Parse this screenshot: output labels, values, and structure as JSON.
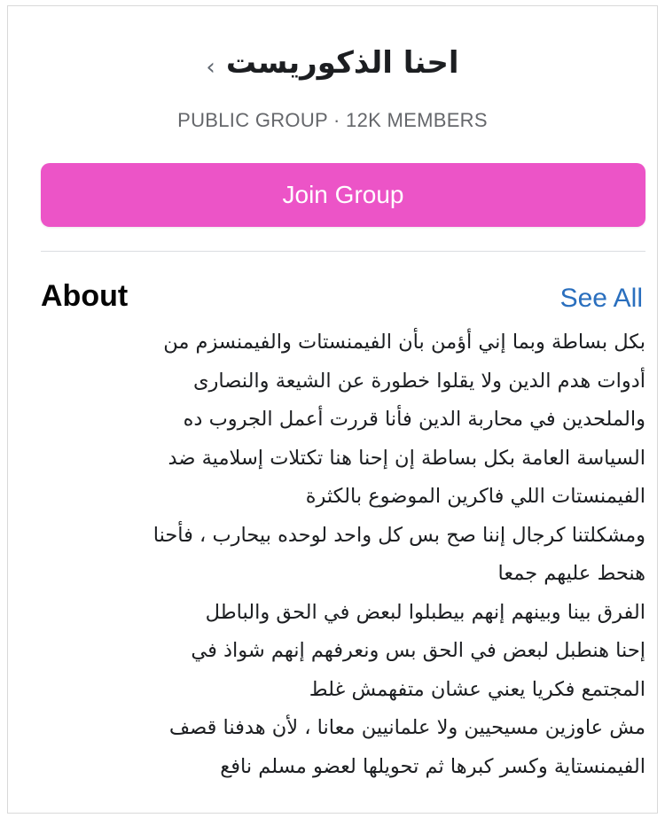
{
  "group": {
    "title": "احنا الذكوريست",
    "chevron_glyph": "‹",
    "meta": "PUBLIC GROUP · 12K MEMBERS",
    "join_label": "Join Group"
  },
  "about": {
    "heading": "About",
    "see_all_label": "See All",
    "lines": [
      "بكل بساطة وبما إني أؤمن بأن الفيمنستات والفيمنسزم من",
      "أدوات هدم الدين ولا يقلوا خطورة عن الشيعة والنصارى",
      "والملحدين في محاربة الدين فأنا قررت أعمل الجروب ده",
      "السياسة العامة بكل بساطة إن إحنا هنا تكتلات إسلامية ضد",
      "الفيمنستات اللي فاكرين الموضوع بالكثرة",
      "ومشكلتنا كرجال إننا صح بس كل واحد لوحده بيحارب ، فأحنا",
      "هنحط عليهم جمعا",
      "الفرق بينا وبينهم إنهم بيطبلوا لبعض في الحق والباطل",
      "إحنا هنطبل لبعض في الحق بس ونعرفهم إنهم شواذ في",
      "المجتمع فكريا يعني عشان متفهمش غلط",
      "مش عاوزين مسيحيين ولا علمانيين معانا ، لأن هدفنا قصف",
      "الفيمنستاية وكسر كبرها ثم تحويلها لعضو مسلم نافع"
    ]
  },
  "colors": {
    "join_button_bg": "#ec54c7",
    "link_blue": "#2a6fbe",
    "meta_gray": "#65676b"
  }
}
